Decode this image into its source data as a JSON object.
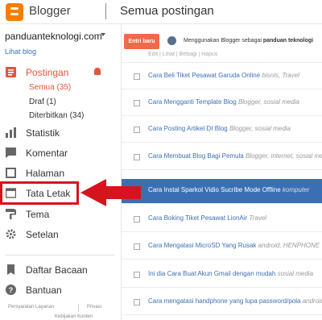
{
  "header": {
    "brand": "Blogger",
    "page_title": "Semua postingan",
    "logo_icon": "blogger-logo-icon",
    "brand_color": "#f57d00"
  },
  "sidebar": {
    "blog_name": "panduanteknologi.com",
    "view_blog": "Lihat blog",
    "items": [
      {
        "label": "Postingan",
        "icon": "posts-icon",
        "active": true
      },
      {
        "label": "Statistik",
        "icon": "stats-icon"
      },
      {
        "label": "Komentar",
        "icon": "comment-icon"
      },
      {
        "label": "Halaman",
        "icon": "pages-icon"
      },
      {
        "label": "Tata Letak",
        "icon": "layout-icon",
        "highlighted": true
      },
      {
        "label": "Tema",
        "icon": "theme-icon"
      },
      {
        "label": "Setelan",
        "icon": "settings-icon"
      },
      {
        "label": "Daftar Bacaan",
        "icon": "reading-list-icon"
      },
      {
        "label": "Bantuan",
        "icon": "help-icon"
      }
    ],
    "sub_items": [
      {
        "label": "Semua (35)",
        "active": true
      },
      {
        "label": "Draf (1)"
      },
      {
        "label": "Diterbitkan (34)"
      }
    ],
    "footer": {
      "terms": "Persyaratan Layanan",
      "privacy": "Privasi",
      "content_policy": "Kebijakan Konten"
    }
  },
  "main": {
    "new_post_label": "Entri baru",
    "using_prefix": "Menggunakan Blogger sebagai",
    "using_name": "panduan teknologi",
    "partial_labels": "Edit | Lihat | Bebagi | Hapus",
    "posts": [
      {
        "title": "Cara Beli Tiket Pesawat Garuda Online",
        "labels": "bisnis, Travel"
      },
      {
        "title": "Cara Mengganti Template Blog",
        "labels": "Blogger, sosial media"
      },
      {
        "title": "Cara Posting Artikel DI Blog",
        "labels": "Blogger, sosial media"
      },
      {
        "title": "Cara Membuat Blog Bagi Pemula",
        "labels": "Blogger, internet, sosial media"
      },
      {
        "title": "Cara Instal Sparkol Vidio Sucribe Mode Offline",
        "labels": "komputer"
      },
      {
        "title": "Cara Boking Tiket Pesawat LionAir",
        "labels": "Travel"
      },
      {
        "title": "Cara Mengatasi MicroSD Yang Rusak",
        "labels": "android, HENPHONE"
      },
      {
        "title": "Ini dia Cara Buat Akun Gmail dengan mudah",
        "labels": "sosial media"
      },
      {
        "title": "Cara mengatasi handphone yang lupa password/pola",
        "labels": "android"
      }
    ]
  },
  "annotation": {
    "color": "#d6141d"
  }
}
